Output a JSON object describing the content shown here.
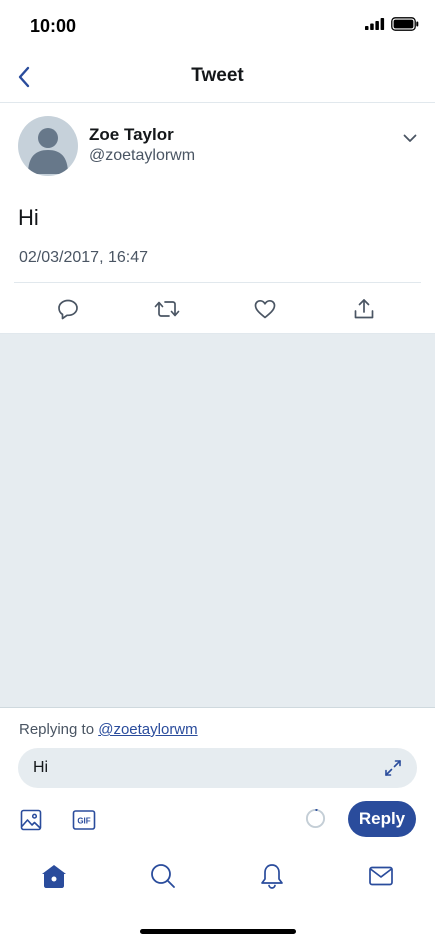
{
  "status_bar": {
    "time": "10:00",
    "icons": [
      "signal-icon",
      "battery-icon"
    ]
  },
  "nav": {
    "title": "Tweet",
    "back_icon": "back-chevron-icon"
  },
  "tweet": {
    "author_name": "Zoe Taylor",
    "author_handle": "@zoetaylorwm",
    "text": "Hi",
    "timestamp": "02/03/2017, 16:47",
    "actions": [
      "reply-icon",
      "retweet-icon",
      "like-icon",
      "share-icon"
    ]
  },
  "reply": {
    "replying_prefix": "Replying to ",
    "replying_handle": "@zoetaylorwm",
    "input_value": "Hi",
    "button_label": "Reply",
    "tools": [
      "image-icon",
      "gif-icon"
    ]
  },
  "tab_bar": {
    "tabs": [
      "home-icon",
      "search-icon",
      "notifications-icon",
      "messages-icon"
    ],
    "active": "home"
  },
  "colors": {
    "accent": "#2a4c9c",
    "background_gray": "#e6ecf0",
    "border": "#e1e8ed",
    "secondary_text": "#4a5563"
  }
}
